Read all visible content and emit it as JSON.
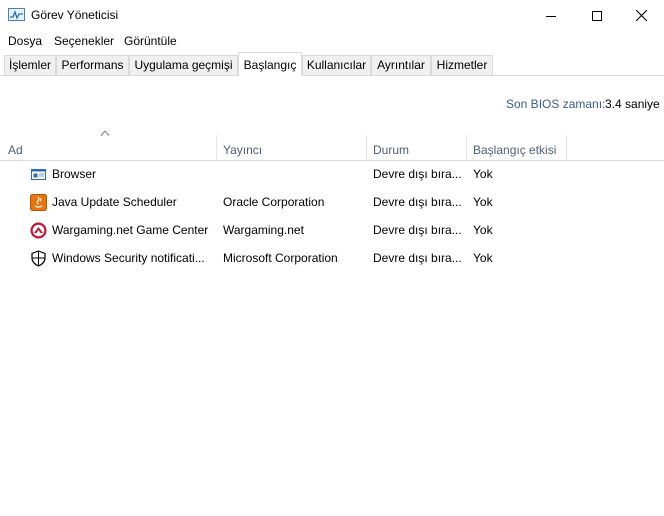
{
  "window": {
    "title": "Görev Yöneticisi",
    "icon": "task-manager-icon",
    "controls": [
      "minimize-icon",
      "maximize-icon",
      "close-icon"
    ]
  },
  "menu": {
    "items": [
      {
        "label": "Dosya"
      },
      {
        "label": "Seçenekler"
      },
      {
        "label": "Görüntüle"
      }
    ]
  },
  "tabs": [
    {
      "label": "İşlemler"
    },
    {
      "label": "Performans"
    },
    {
      "label": "Uygulama geçmişi"
    },
    {
      "label": "Başlangıç",
      "active": true
    },
    {
      "label": "Kullanıcılar"
    },
    {
      "label": "Ayrıntılar"
    },
    {
      "label": "Hizmetler"
    }
  ],
  "bios": {
    "label": "Son BIOS zamanı:",
    "value": "3.4 saniye"
  },
  "table": {
    "columns": [
      {
        "label": "Ad"
      },
      {
        "label": "Yayıncı"
      },
      {
        "label": "Durum"
      },
      {
        "label": "Başlangıç etkisi"
      }
    ],
    "rows": [
      {
        "icon": "browser-window-icon",
        "name": "Browser",
        "publisher": "",
        "status": "Devre dışı bıra...",
        "impact": "Yok"
      },
      {
        "icon": "java-icon",
        "name": "Java Update Scheduler",
        "publisher": "Oracle Corporation",
        "status": "Devre dışı bıra...",
        "impact": "Yok"
      },
      {
        "icon": "wargaming-icon",
        "name": "Wargaming.net Game Center",
        "publisher": "Wargaming.net",
        "status": "Devre dışı bıra...",
        "impact": "Yok"
      },
      {
        "icon": "shield-icon",
        "name": "Windows Security notificati...",
        "publisher": "Microsoft Corporation",
        "status": "Devre dışı bıra...",
        "impact": "Yok"
      }
    ]
  },
  "colors": {
    "header_text": "#4c607a",
    "bios_label": "#3a5a8c",
    "tab_inactive_bg": "#f0f0f0",
    "border": "#d9d9d9"
  }
}
